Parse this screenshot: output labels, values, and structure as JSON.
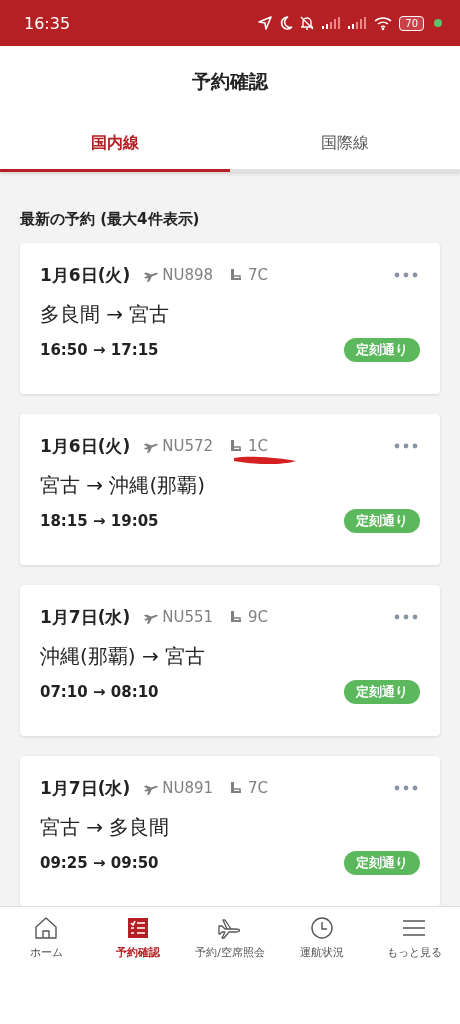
{
  "status_bar": {
    "time": "16:35",
    "battery": "70"
  },
  "header": {
    "title": "予約確認"
  },
  "tabs": [
    {
      "label": "国内線",
      "selected": true
    },
    {
      "label": "国際線",
      "selected": false
    }
  ],
  "section_title": "最新の予約 (最大4件表示)",
  "bookings": [
    {
      "date": "1月6日(火)",
      "flight": "NU898",
      "seat": "7C",
      "route": "多良間 → 宮古",
      "times": "16:50 → 17:15",
      "status": "定刻通り",
      "scribbled": false
    },
    {
      "date": "1月6日(火)",
      "flight": "NU572",
      "seat": "1C",
      "route": "宮古 → 沖縄(那覇)",
      "times": "18:15 → 19:05",
      "status": "定刻通り",
      "scribbled": true
    },
    {
      "date": "1月7日(水)",
      "flight": "NU551",
      "seat": "9C",
      "route": "沖縄(那覇) → 宮古",
      "times": "07:10 → 08:10",
      "status": "定刻通り",
      "scribbled": false
    },
    {
      "date": "1月7日(水)",
      "flight": "NU891",
      "seat": "7C",
      "route": "宮古 → 多良間",
      "times": "09:25 → 09:50",
      "status": "定刻通り",
      "scribbled": false
    }
  ],
  "nav": [
    {
      "kind": "home",
      "label": "ホーム",
      "selected": false
    },
    {
      "kind": "list",
      "label": "予約確認",
      "selected": true
    },
    {
      "kind": "plane",
      "label": "予約/空席照会",
      "selected": false
    },
    {
      "kind": "clock",
      "label": "運航状況",
      "selected": false
    },
    {
      "kind": "menu",
      "label": "もっと見る",
      "selected": false
    }
  ]
}
